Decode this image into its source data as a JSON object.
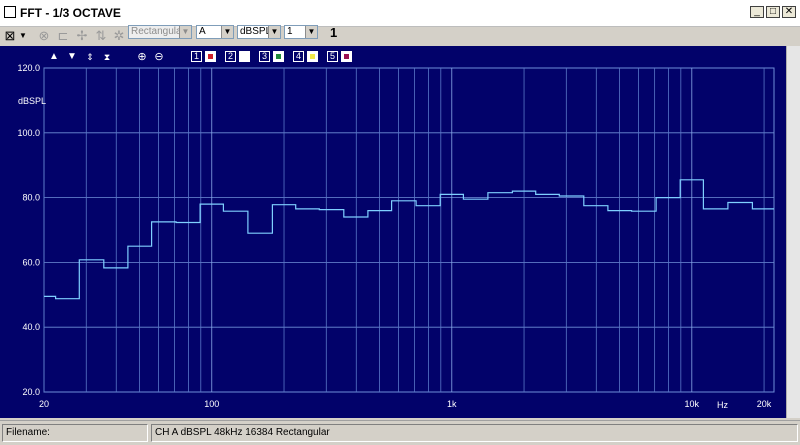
{
  "window": {
    "title": "FFT - 1/3 OCTAVE",
    "minimize_glyph": "_",
    "maximize_glyph": "□",
    "close_glyph": "✕"
  },
  "toolbar": {
    "window_select": "Rectangular",
    "weighting_select": "A",
    "unit_select": "dBSPL",
    "channel_select": "1",
    "count_value": "1"
  },
  "plot_controls": {
    "channels": [
      {
        "label": "1",
        "color": "#d0202a"
      },
      {
        "label": "2",
        "color": "#ffffff"
      },
      {
        "label": "3",
        "color": "#1f8a3a"
      },
      {
        "label": "4",
        "color": "#f2e94a"
      },
      {
        "label": "5",
        "color": "#9a1050"
      }
    ]
  },
  "chart_data": {
    "type": "line",
    "ylabel": "dBSPL",
    "xlabel": "Hz",
    "x_scale": "log",
    "xlim": [
      20,
      22000
    ],
    "ylim": [
      20,
      120
    ],
    "grid": true,
    "y_ticks": [
      {
        "value": 20,
        "label": "20.0"
      },
      {
        "value": 40,
        "label": "40.0"
      },
      {
        "value": 60,
        "label": "60.0"
      },
      {
        "value": 80,
        "label": "80.0"
      },
      {
        "value": 100,
        "label": "100.0"
      },
      {
        "value": 120,
        "label": "120.0"
      }
    ],
    "x_tick_labels": [
      {
        "value": 20,
        "label": "20"
      },
      {
        "value": 100,
        "label": "100"
      },
      {
        "value": 1000,
        "label": "1k"
      },
      {
        "value": 10000,
        "label": "10k"
      },
      {
        "value": 20000,
        "label": "20k"
      }
    ],
    "series": [
      {
        "color": "#7fd0ff",
        "x": [
          20,
          25,
          31.5,
          40,
          50,
          63,
          80,
          100,
          125,
          160,
          200,
          250,
          315,
          400,
          500,
          630,
          800,
          1000,
          1250,
          1600,
          2000,
          2500,
          3150,
          4000,
          5000,
          6300,
          8000,
          10000,
          12500,
          16000,
          20000
        ],
        "values": [
          49.5,
          48.8,
          60.8,
          58.3,
          65.0,
          72.5,
          72.3,
          78.0,
          75.8,
          69.0,
          77.8,
          76.5,
          76.3,
          74.0,
          76.0,
          79.0,
          77.5,
          81.0,
          79.5,
          81.5,
          82.0,
          81.0,
          80.5,
          77.5,
          76.0,
          75.8,
          80.0,
          85.5,
          76.5,
          78.5,
          76.5
        ]
      }
    ]
  },
  "status": {
    "filename_label": "Filename:",
    "filename_value": "",
    "info": "CH A   dBSPL   48kHz   16384   Rectangular"
  }
}
